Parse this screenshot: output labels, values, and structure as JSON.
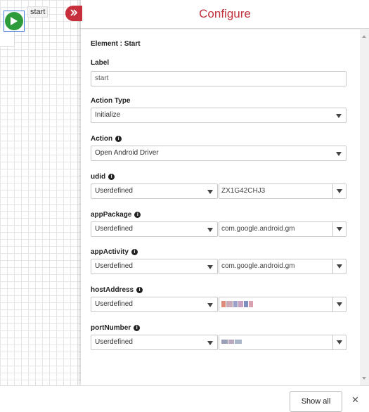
{
  "canvas": {
    "start_node_label": "start"
  },
  "panel": {
    "title": "Configure",
    "element_title": "Element : Start",
    "fields": {
      "label": {
        "label": "Label",
        "value": "start"
      },
      "action_type": {
        "label": "Action Type",
        "value": "Initialize"
      },
      "action": {
        "label": "Action",
        "value": "Open Android Driver"
      },
      "udid": {
        "label": "udid",
        "mode": "Userdefined",
        "value": "ZX1G42CHJ3"
      },
      "app_package": {
        "label": "appPackage",
        "mode": "Userdefined",
        "value": "com.google.android.gm"
      },
      "app_activity": {
        "label": "appActivity",
        "mode": "Userdefined",
        "value": "com.google.android.gm"
      },
      "host_address": {
        "label": "hostAddress",
        "mode": "Userdefined"
      },
      "port_number": {
        "label": "portNumber",
        "mode": "Userdefined"
      }
    }
  },
  "bottom_bar": {
    "show_all_label": "Show all",
    "close_glyph": "✕"
  },
  "icons": {
    "info": "info-icon",
    "collapse": "chevron-double-right-icon",
    "play": "play-icon"
  },
  "colors": {
    "accent": "#c0303c",
    "start_green": "#2e9b3a"
  }
}
